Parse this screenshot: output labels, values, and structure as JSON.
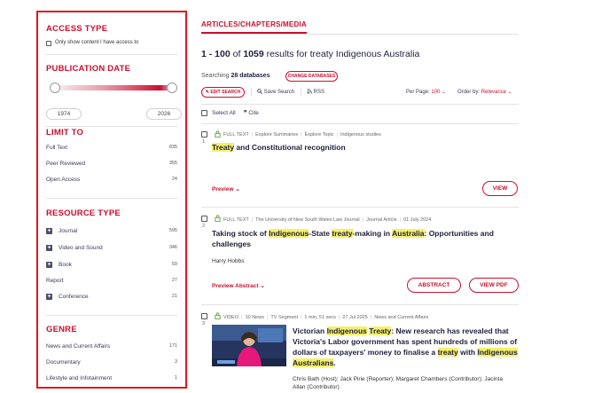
{
  "sidebar": {
    "access": {
      "heading": "ACCESS TYPE",
      "checkbox_label": "Only show content I have access to"
    },
    "pubdate": {
      "heading": "PUBLICATION DATE",
      "from": "1974",
      "to": "2026"
    },
    "limit": {
      "heading": "LIMIT TO",
      "items": [
        {
          "label": "Full Text",
          "count": "835"
        },
        {
          "label": "Peer Reviewed",
          "count": "355"
        },
        {
          "label": "Open Access",
          "count": "24"
        }
      ]
    },
    "resource": {
      "heading": "RESOURCE TYPE",
      "items": [
        {
          "label": "Journal",
          "count": "595",
          "expand": "+"
        },
        {
          "label": "Video and Sound",
          "count": "346",
          "expand": "+"
        },
        {
          "label": "Book",
          "count": "59",
          "expand": "+"
        },
        {
          "label": "Report",
          "count": "27"
        },
        {
          "label": "Conference",
          "count": "21",
          "expand": "+"
        }
      ]
    },
    "genre": {
      "heading": "GENRE",
      "items": [
        {
          "label": "News and Current Affairs",
          "count": "171"
        },
        {
          "label": "Documentary",
          "count": "3"
        },
        {
          "label": "Lifestyle and Infotainment",
          "count": "1"
        }
      ]
    }
  },
  "main": {
    "tab": "ARTICLES/CHAPTERS/MEDIA",
    "results": {
      "range": "1 - 100",
      "of": "of",
      "total": "1059",
      "for": "results for",
      "query": "treaty Indigenous Australia"
    },
    "searching": {
      "prefix": "Searching",
      "count": "28 databases",
      "change": "CHANGE DATABASES"
    },
    "toolbar": {
      "edit": "EDIT SEARCH",
      "save": "Save Search",
      "rss": "RSS",
      "per_page_label": "Per Page:",
      "per_page": "100",
      "order_label": "Order by:",
      "order": "Relevance"
    },
    "select_all": "Select All",
    "cite": "Cite",
    "results_list": [
      {
        "index": "1",
        "meta": [
          "FULL TEXT",
          "Explore Summaries",
          "Explore Topic",
          "Indigenous studies"
        ],
        "title_parts": [
          "Treaty",
          " and Constitutional recognition"
        ],
        "preview": "Preview",
        "view": "VIEW"
      },
      {
        "index": "2",
        "meta": [
          "FULL TEXT",
          "The University of New South Wales Law Journal",
          "Journal Article",
          "01 July 2024"
        ],
        "title_parts": [
          "Taking stock of ",
          "Indigenous",
          "-State ",
          "treaty",
          "-making in ",
          "Australia",
          ": Opportunities and challenges"
        ],
        "authors": "Harry Hobbs",
        "preview": "Preview Abstract",
        "abstract": "ABSTRACT",
        "pdf": "VIEW PDF"
      },
      {
        "index": "3",
        "meta": [
          "VIDEO",
          "10 News",
          "TV Segment",
          "1 min, 51 secs",
          "27 Jul 2025",
          "News and Current Affairs"
        ],
        "title_parts": [
          "Victorian ",
          "Indigenous",
          " ",
          "Treaty",
          ": New research has revealed that Victoria's Labor government has spent hundreds of millions of dollars of taxpayers' money to finalise a ",
          "treaty",
          " with ",
          "Indigenous Australians",
          "."
        ],
        "authors": "Chris Bath (Host); Jack Pirie (Reporter); Margaret Chambers (Contributor); Jacinta Allan (Contributor)"
      }
    ]
  },
  "colors": {
    "accent": "#c8102e",
    "highlight": "#f5f06a",
    "navy": "#1f1f3d"
  }
}
